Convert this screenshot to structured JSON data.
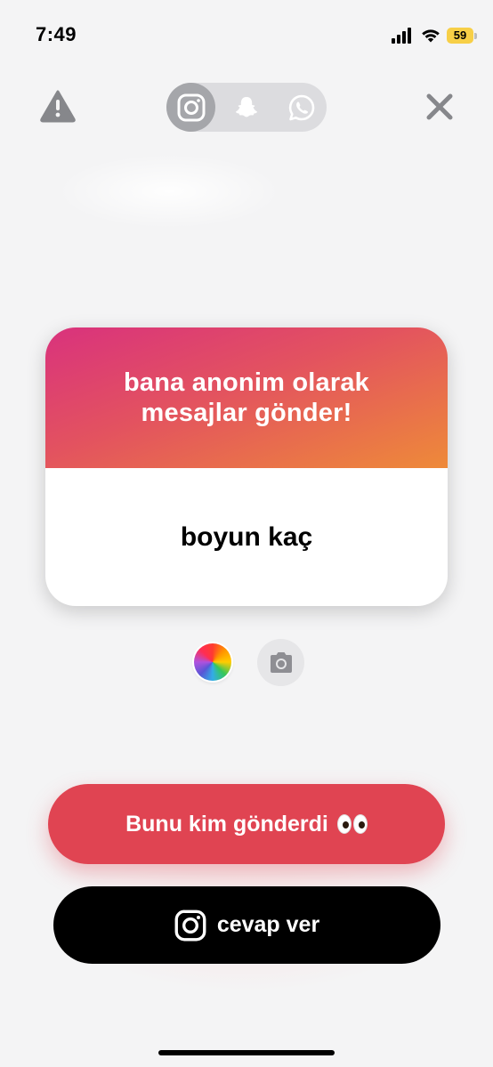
{
  "status_bar": {
    "time": "7:49",
    "battery": "59",
    "battery_color": "#f7cf47"
  },
  "top_bar": {
    "warning_icon": "warning-triangle-icon",
    "close_icon": "close-icon",
    "share_targets": [
      {
        "icon": "instagram-icon",
        "selected": true
      },
      {
        "icon": "snapchat-icon",
        "selected": false
      },
      {
        "icon": "whatsapp-icon",
        "selected": false
      }
    ]
  },
  "card": {
    "title": "bana anonim olarak mesajlar gönder!",
    "question": "boyun kaç",
    "gradient_colors": [
      "#d9327d",
      "#e3535f",
      "#ee8a39"
    ]
  },
  "tools": {
    "color_icon": "color-wheel-icon",
    "camera_icon": "camera-icon"
  },
  "actions": {
    "who_sent_label": "Bunu kim gönderdi",
    "who_sent_color": "#e04452",
    "reply_label": "cevap ver"
  }
}
